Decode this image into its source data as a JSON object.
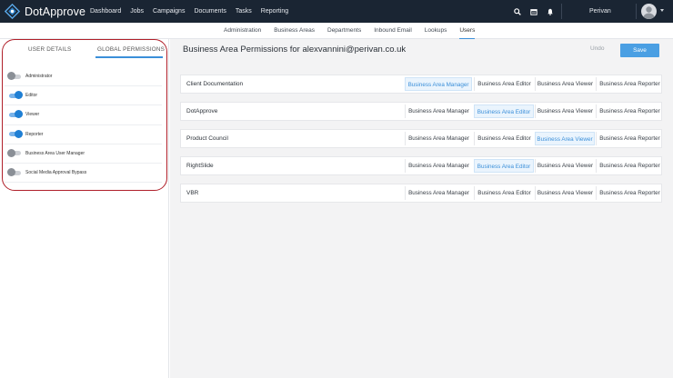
{
  "app": {
    "name": "DotApprove",
    "nav": [
      "Dashboard",
      "Jobs",
      "Campaigns",
      "Documents",
      "Tasks",
      "Reporting"
    ],
    "user": "Perivan"
  },
  "subnav": {
    "items": [
      "Administration",
      "Business Areas",
      "Departments",
      "Inbound Email",
      "Lookups",
      "Users"
    ],
    "active_index": 5
  },
  "left_panel": {
    "tabs": [
      "USER DETAILS",
      "GLOBAL PERMISSIONS"
    ],
    "active_tab_index": 1,
    "permissions": [
      {
        "label": "Administrator",
        "on": false
      },
      {
        "label": "Editor",
        "on": true
      },
      {
        "label": "Viewer",
        "on": true
      },
      {
        "label": "Reporter",
        "on": true
      },
      {
        "label": "Business Area User Manager",
        "on": false
      },
      {
        "label": "Social Media Approval Bypass",
        "on": false
      }
    ]
  },
  "main": {
    "title": "Business Area Permissions for alexvannini@perivan.co.uk",
    "undo_label": "Undo",
    "save_label": "Save",
    "roles": [
      "Business Area Manager",
      "Business Area Editor",
      "Business Area Viewer",
      "Business Area Reporter"
    ],
    "business_areas": [
      {
        "name": "Client Documentation",
        "selected_role_index": 0
      },
      {
        "name": "DotApprove",
        "selected_role_index": 1
      },
      {
        "name": "Product Council",
        "selected_role_index": 2
      },
      {
        "name": "RightSlide",
        "selected_role_index": 1
      },
      {
        "name": "VBR",
        "selected_role_index": -1
      }
    ]
  },
  "colors": {
    "topbar": "#1a2533",
    "accent": "#3b8fd9",
    "save_button": "#4a9fe3",
    "highlight_outline": "#b0202a"
  }
}
